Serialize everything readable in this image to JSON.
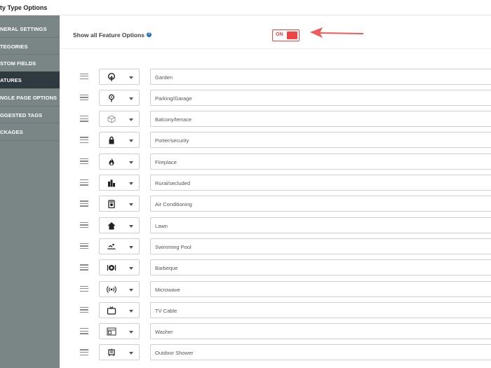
{
  "page": {
    "title": "ty Type Options"
  },
  "sidebar": {
    "items": [
      {
        "label": "NERAL SETTINGS",
        "active": false
      },
      {
        "label": "TEGORIES",
        "active": false
      },
      {
        "label": "STOM FIELDS",
        "active": false
      },
      {
        "label": "ATURES",
        "active": true
      },
      {
        "label": "NGLE PAGE OPTIONS",
        "active": false
      },
      {
        "label": "GGESTED TAGS",
        "active": false
      },
      {
        "label": "CKAGES",
        "active": false
      }
    ]
  },
  "header": {
    "label": "Show all Feature Options",
    "help": "?",
    "toggle_label": "ON",
    "toggle_state": "on"
  },
  "colors": {
    "accent": "#f04444",
    "sidebar_bg": "#7a8685",
    "sidebar_active": "#2e3940",
    "help": "#2272b9"
  },
  "features": [
    {
      "name": "Garden",
      "icon": "tree-icon"
    },
    {
      "name": "Parking/Garage",
      "icon": "map-pin-icon"
    },
    {
      "name": "Balcony/terrace",
      "icon": "cube-icon"
    },
    {
      "name": "Porter/security",
      "icon": "lock-icon"
    },
    {
      "name": "Fireplace",
      "icon": "fire-icon"
    },
    {
      "name": "Rural/secluded",
      "icon": "buildings-icon"
    },
    {
      "name": "Air Conditioning",
      "icon": "air-conditioner-icon"
    },
    {
      "name": "Lawn",
      "icon": "house-icon"
    },
    {
      "name": "Swimming Pool",
      "icon": "swimmer-icon"
    },
    {
      "name": "Barbeque",
      "icon": "grill-icon"
    },
    {
      "name": "Microwave",
      "icon": "signal-icon"
    },
    {
      "name": "TV Cable",
      "icon": "tv-icon"
    },
    {
      "name": "Washer",
      "icon": "washer-icon"
    },
    {
      "name": "Outdoor Shower",
      "icon": "shower-icon"
    }
  ]
}
